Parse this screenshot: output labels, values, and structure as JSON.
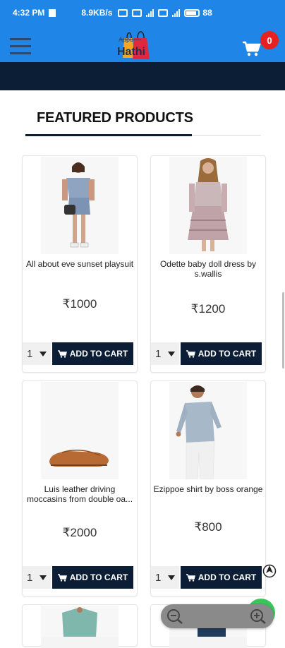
{
  "status_bar": {
    "time": "4:32 PM",
    "network_speed": "8.9KB/s",
    "battery_percent": "88"
  },
  "header": {
    "logo_text": "Hathi",
    "logo_small_text": "Appu",
    "cart_count": "0"
  },
  "section": {
    "title": "FEATURED PRODUCTS"
  },
  "products": [
    {
      "name": "All about eve sunset playsuit",
      "price": "₹1000",
      "qty": "1",
      "button": "ADD TO CART"
    },
    {
      "name": "Odette baby doll dress by s.wallis",
      "price": "₹1200",
      "qty": "1",
      "button": "ADD TO CART"
    },
    {
      "name": "Luis leather driving moccasins from double oa...",
      "price": "₹2000",
      "qty": "1",
      "button": "ADD TO CART"
    },
    {
      "name": "Ezippoe shirt by boss orange",
      "price": "₹800",
      "qty": "1",
      "button": "ADD TO CART"
    }
  ],
  "colors": {
    "header_blue": "#1f86e8",
    "navy": "#0c1e36",
    "badge_red": "#e52121"
  }
}
